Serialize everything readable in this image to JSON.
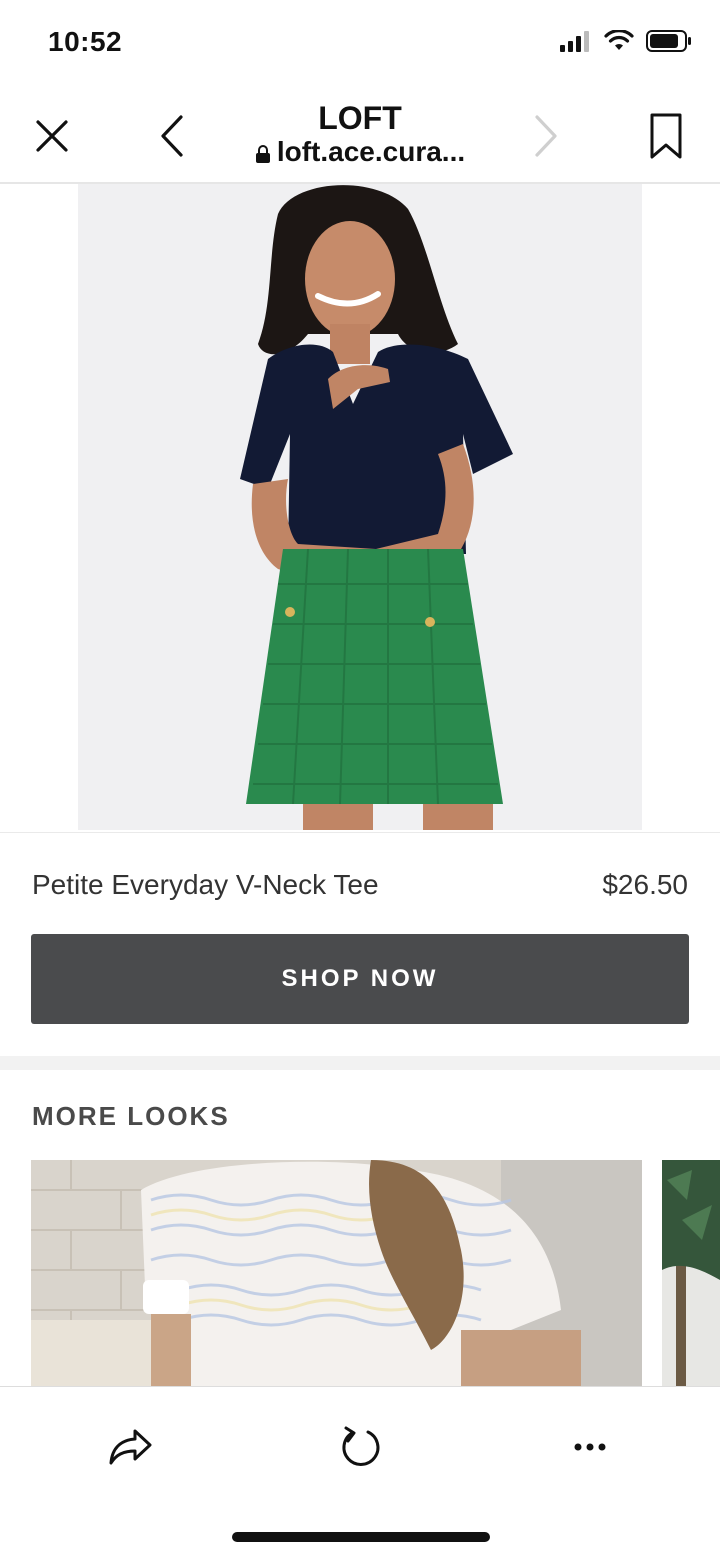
{
  "status_bar": {
    "time": "10:52"
  },
  "browser": {
    "site_name": "LOFT",
    "url": "loft.ace.cura..."
  },
  "hero_image": {
    "description_icon": "product-photo"
  },
  "product": {
    "name": "Petite Everyday V-Neck Tee",
    "price": "$26.50",
    "cta_label": "SHOP NOW"
  },
  "more_looks": {
    "title": "MORE LOOKS"
  },
  "toolbar": {
    "icons": [
      "share-icon",
      "refresh-icon",
      "more-icon"
    ]
  },
  "colors": {
    "cta_bg": "#4a4b4d",
    "skirt_green": "#2a8a4e",
    "tee_navy": "#111a33"
  }
}
